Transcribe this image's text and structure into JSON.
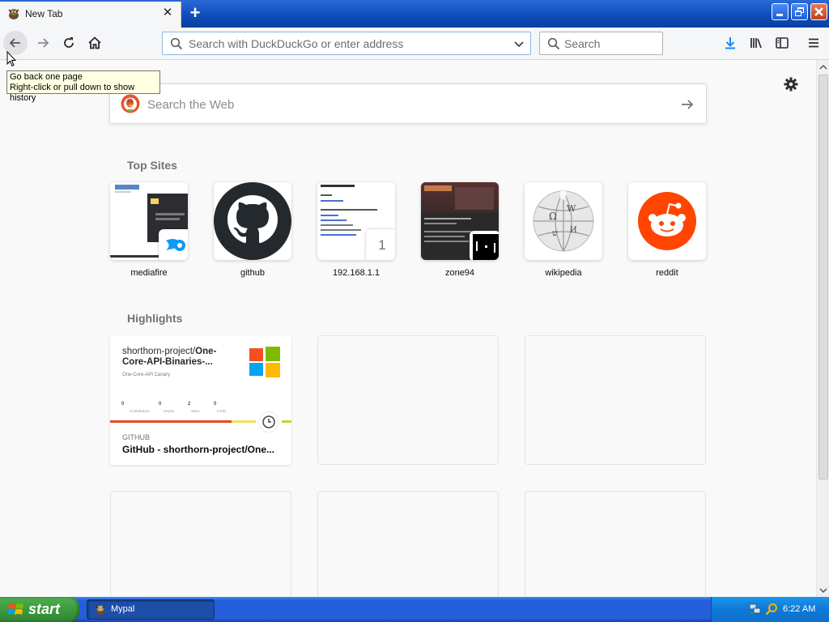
{
  "tab": {
    "title": "New Tab"
  },
  "toolbar": {
    "url_placeholder": "Search with DuckDuckGo or enter address",
    "search_placeholder": "Search"
  },
  "tooltip": {
    "line1": "Go back one page",
    "line2": "Right-click or pull down to show history"
  },
  "newtab": {
    "websearch_placeholder": "Search the Web",
    "top_sites_title": "Top Sites",
    "highlights_title": "Highlights",
    "top_sites": [
      {
        "label": "mediafire"
      },
      {
        "label": "github"
      },
      {
        "label": "192.168.1.1",
        "badge": "1"
      },
      {
        "label": "zone94"
      },
      {
        "label": "wikipedia"
      },
      {
        "label": "reddit"
      }
    ],
    "highlight": {
      "repo_owner": "shorthorn-project/",
      "repo_name_line1": "One-",
      "repo_name_line2": "Core-API-Binaries-...",
      "description": "One-Core-API Canary",
      "stats": [
        {
          "value": "0",
          "label": "Contributors"
        },
        {
          "value": "0",
          "label": "Issues"
        },
        {
          "value": "2",
          "label": "Stars"
        },
        {
          "value": "0",
          "label": "Forks"
        }
      ],
      "source": "GITHUB",
      "title": "GitHub - shorthorn-project/One..."
    }
  },
  "taskbar": {
    "start_label": "start",
    "task_label": "Mypal",
    "clock": "6:22 AM"
  },
  "colors": {
    "accent_blue": "#0a84ff",
    "reddit": "#ff4500",
    "github": "#24292e",
    "xp_blue": "#245edb",
    "xp_green": "#3c9b3e"
  }
}
